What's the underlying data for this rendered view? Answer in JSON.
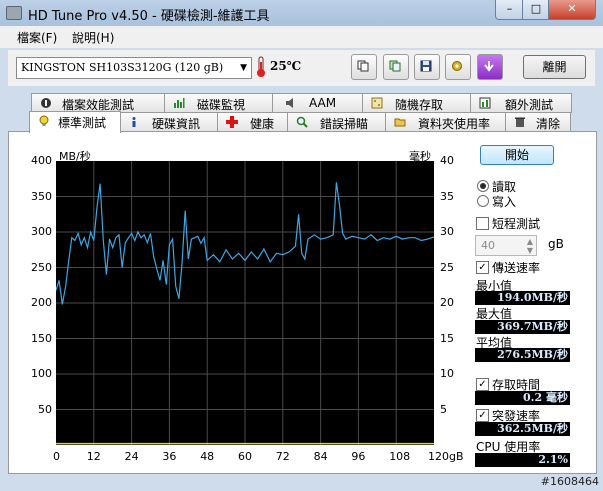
{
  "window": {
    "title": "HD Tune Pro v4.50 - 硬碟檢測-維護工具",
    "min_label": "–",
    "max_label": "□",
    "close_label": "✕"
  },
  "menu": [
    {
      "label": "檔案(F)"
    },
    {
      "label": "說明(H)"
    }
  ],
  "toolbar": {
    "drive": "KINGSTON SH103S3120G    (120 gB)",
    "temperature": "25℃",
    "exit_label": "離開"
  },
  "tabs_top": [
    {
      "label": "檔案效能測試",
      "icon": "file-benchmark-icon"
    },
    {
      "label": "磁碟監視",
      "icon": "disk-monitor-icon"
    },
    {
      "label": "AAM",
      "icon": "speaker-icon"
    },
    {
      "label": "隨機存取",
      "icon": "random-access-icon"
    },
    {
      "label": "額外測試",
      "icon": "extra-tests-icon"
    }
  ],
  "tabs_bottom": [
    {
      "label": "標準測試",
      "icon": "benchmark-icon",
      "active": true
    },
    {
      "label": "硬碟資訊",
      "icon": "info-icon"
    },
    {
      "label": "健康",
      "icon": "health-cross-icon"
    },
    {
      "label": "錯誤掃瞄",
      "icon": "magnifier-icon"
    },
    {
      "label": "資料夾使用率",
      "icon": "folder-icon"
    },
    {
      "label": "清除",
      "icon": "trash-icon"
    }
  ],
  "chart_data": {
    "type": "line",
    "left_unit": "MB/秒",
    "right_unit": "毫秒",
    "x_ticks": [
      "0",
      "12",
      "24",
      "36",
      "48",
      "60",
      "72",
      "84",
      "96",
      "108",
      "120gB"
    ],
    "y_ticks_left": [
      "400",
      "350",
      "300",
      "250",
      "200",
      "150",
      "100",
      "50"
    ],
    "y_ticks_right": [
      "40",
      "35",
      "30",
      "25",
      "20",
      "15",
      "10",
      "5"
    ],
    "xlim": [
      0,
      120
    ],
    "ylim": [
      0,
      400
    ],
    "grid": true,
    "series": [
      {
        "color": "#3ea6e0",
        "x": [
          0,
          1,
          2,
          3,
          4,
          5,
          6,
          7,
          8,
          9,
          10,
          11,
          12,
          13,
          14,
          15,
          16,
          17,
          18,
          19,
          20,
          21,
          22,
          23,
          24,
          25,
          26,
          27,
          28,
          29,
          30,
          31,
          32,
          33,
          34,
          35,
          36,
          37,
          38,
          39,
          40,
          41,
          42,
          43,
          44,
          45,
          46,
          47,
          48,
          50,
          52,
          54,
          56,
          58,
          60,
          62,
          64,
          66,
          68,
          70,
          72,
          74,
          76,
          77,
          78,
          79,
          80,
          82,
          84,
          86,
          88,
          89,
          90,
          91,
          92,
          94,
          96,
          98,
          100,
          102,
          104,
          106,
          108,
          110,
          112,
          114,
          116,
          118,
          120
        ],
        "y": [
          218,
          232,
          198,
          222,
          258,
          292,
          288,
          298,
          282,
          292,
          278,
          300,
          288,
          335,
          368,
          288,
          240,
          290,
          278,
          292,
          296,
          250,
          285,
          292,
          298,
          288,
          300,
          292,
          296,
          285,
          298,
          265,
          248,
          232,
          260,
          226,
          282,
          290,
          224,
          206,
          255,
          330,
          262,
          290,
          292,
          294,
          284,
          292,
          260,
          268,
          258,
          275,
          262,
          270,
          260,
          272,
          262,
          276,
          258,
          270,
          268,
          272,
          280,
          325,
          270,
          262,
          290,
          296,
          290,
          292,
          296,
          370,
          338,
          298,
          290,
          294,
          292,
          290,
          296,
          288,
          292,
          290,
          294,
          290,
          292,
          292,
          288,
          290,
          293
        ]
      },
      {
        "color": "#e0d23a",
        "x": [
          0,
          10,
          20,
          30,
          40,
          50,
          60,
          70,
          80,
          90,
          100,
          110,
          120
        ],
        "y": [
          2,
          2,
          2,
          2,
          2,
          2,
          2,
          2,
          2,
          2,
          2,
          2,
          2
        ]
      }
    ]
  },
  "controls": {
    "start_label": "開始",
    "read_label": "讀取",
    "write_label": "寫入",
    "short_test_label": "短程測試",
    "short_value": "40",
    "gb_unit": "gB",
    "transfer_label": "傳送速率",
    "min_label": "最小值",
    "min_value": "194.0MB/秒",
    "max_label": "最大值",
    "max_value": "369.7MB/秒",
    "avg_label": "平均值",
    "avg_value": "276.5MB/秒",
    "access_label": "存取時間",
    "access_value": "0.2 毫秒",
    "burst_label": "突發速率",
    "burst_value": "362.5MB/秒",
    "cpu_label": "CPU 使用率",
    "cpu_value": "2.1%"
  },
  "watermark": "#1608464"
}
